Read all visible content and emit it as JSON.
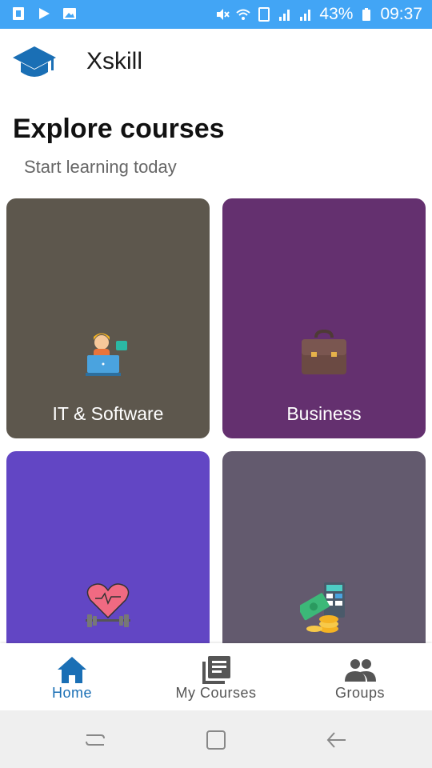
{
  "status_bar": {
    "battery": "43%",
    "time": "09:37"
  },
  "app": {
    "title": "Xskill",
    "logo_icon": "graduation-cap-icon"
  },
  "page": {
    "title": "Explore courses",
    "subtitle": "Start learning today"
  },
  "courses": [
    {
      "label": "IT & Software",
      "color": "#5d574d",
      "icon": "developer-laptop-icon"
    },
    {
      "label": "Business",
      "color": "#64306f",
      "icon": "briefcase-icon"
    },
    {
      "label": "",
      "color": "#6246c4",
      "icon": "heart-dumbbell-icon"
    },
    {
      "label": "",
      "color": "#635a6e",
      "icon": "money-calculator-icon"
    }
  ],
  "bottom_nav": {
    "items": [
      {
        "label": "Home",
        "icon": "home-icon",
        "active": true
      },
      {
        "label": "My Courses",
        "icon": "library-books-icon",
        "active": false
      },
      {
        "label": "Groups",
        "icon": "groups-icon",
        "active": false
      }
    ],
    "active_color": "#1a6fb5",
    "inactive_color": "#555555"
  }
}
